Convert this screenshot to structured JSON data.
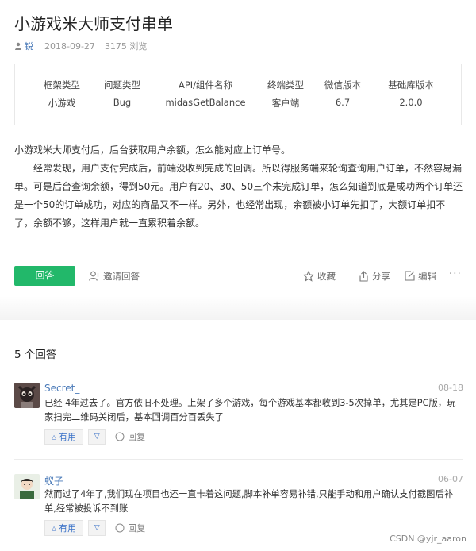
{
  "question": {
    "title": "小游戏米大师支付串单",
    "author": "锐",
    "date": "2018-09-27",
    "views": "3175 浏览"
  },
  "info_table": {
    "headers": [
      "框架类型",
      "问题类型",
      "API/组件名称",
      "终端类型",
      "微信版本",
      "基础库版本"
    ],
    "values": [
      "小游戏",
      "Bug",
      "midasGetBalance",
      "客户端",
      "6.7",
      "2.0.0"
    ]
  },
  "body": {
    "p1": "小游戏米大师支付后，后台获取用户余额，怎么能对应上订单号。",
    "p2": "经常发现，用户支付完成后，前端没收到完成的回调。所以得服务端来轮询查询用户订单，不然容易漏单。可是后台查询余额，得到50元。用户有20、30、50三个未完成订单，怎么知道到底是成功两个订单还是一个50的订单成功，对应的商品又不一样。另外，也经常出现，余额被小订单先扣了，大额订单扣不了，余额不够，这样用户就一直累积着余额。"
  },
  "actions": {
    "answer": "回答",
    "invite": "邀请回答",
    "favorite": "收藏",
    "share": "分享",
    "edit": "编辑",
    "more": "···"
  },
  "answers_title": "5 个回答",
  "answers": [
    {
      "name": "Secret_",
      "date": "08-18",
      "text": "已经 4年过去了。官方依旧不处理。上架了多个游戏，每个游戏基本都收到3-5次掉单，尤其是PC版，玩家扫完二维码关闭后，基本回调百分百丢失了",
      "useful": "有用",
      "reply": "回复"
    },
    {
      "name": "蚁子",
      "date": "06-07",
      "text": "然而过了4年了,我们现在项目也还一直卡着这问题,脚本补单容易补错,只能手动和用户确认支付截图后补单,经常被投诉不到账",
      "useful": "有用",
      "reply": "回复"
    }
  ],
  "watermark": "CSDN @yjr_aaron"
}
